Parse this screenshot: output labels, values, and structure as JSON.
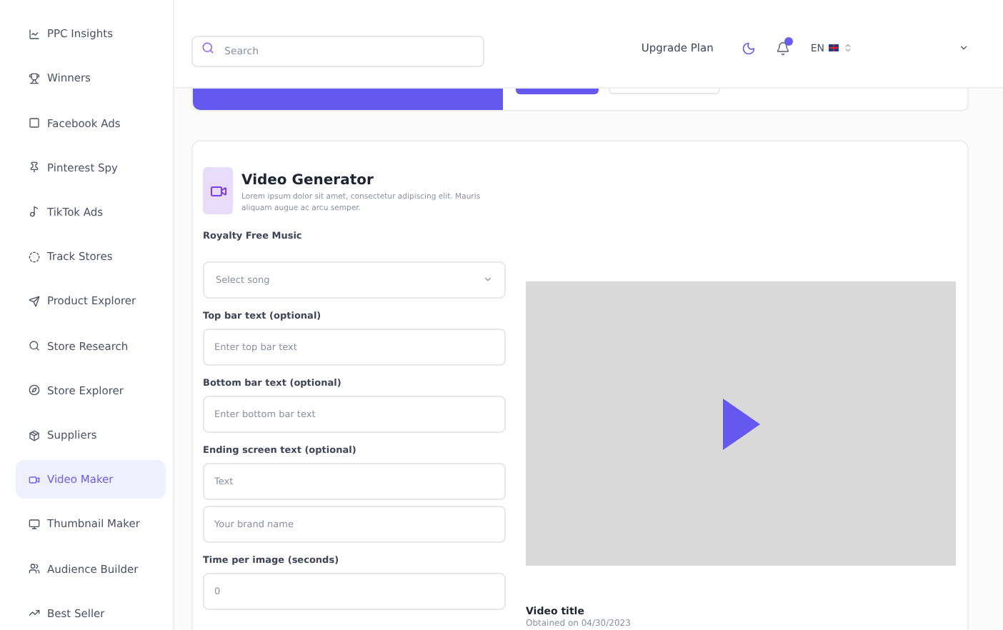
{
  "sidebar": {
    "items": [
      {
        "label": "PPC Insights",
        "selected": false
      },
      {
        "label": "Winners",
        "selected": false
      },
      {
        "label": "Facebook Ads",
        "selected": false
      },
      {
        "label": "Pinterest Spy",
        "selected": false
      },
      {
        "label": "TikTok Ads",
        "selected": false
      },
      {
        "label": "Track Stores",
        "selected": false
      },
      {
        "label": "Product Explorer",
        "selected": false
      },
      {
        "label": "Store Research",
        "selected": false
      },
      {
        "label": "Store Explorer",
        "selected": false
      },
      {
        "label": "Suppliers",
        "selected": false
      },
      {
        "label": "Video Maker",
        "selected": true
      },
      {
        "label": "Thumbnail Maker",
        "selected": false
      },
      {
        "label": "Audience Builder",
        "selected": false
      },
      {
        "label": "Best Seller",
        "selected": false
      }
    ]
  },
  "header": {
    "search": {
      "placeholder": "Search"
    },
    "upgrade": "Upgrade Plan",
    "notifications": {
      "unread": true
    },
    "language": "EN"
  },
  "generator": {
    "title": "Video Generator",
    "description": "Lorem ipsum dolor sit amet, consectetur adipiscing elit. Mauris aliquam augue ac arcu semper.",
    "groups": [
      {
        "label": "Royalty Free Music",
        "inputs": [
          {
            "kind": "select",
            "placeholder": "Select song"
          }
        ]
      },
      {
        "label": "Top bar text (optional)",
        "inputs": [
          {
            "kind": "text",
            "placeholder": "Enter top bar text"
          }
        ]
      },
      {
        "label": "Bottom bar text (optional)",
        "inputs": [
          {
            "kind": "text",
            "placeholder": "Enter bottom bar text"
          }
        ]
      },
      {
        "label": "Ending screen text (optional)",
        "inputs": [
          {
            "kind": "text",
            "placeholder": "Text"
          },
          {
            "kind": "text",
            "placeholder": "Your brand name"
          }
        ]
      },
      {
        "label": "Time per image (seconds)",
        "inputs": [
          {
            "kind": "text",
            "placeholder": "0"
          }
        ]
      }
    ],
    "preview_title": "Video title",
    "footnote": "Obtained on 04/30/2023"
  }
}
